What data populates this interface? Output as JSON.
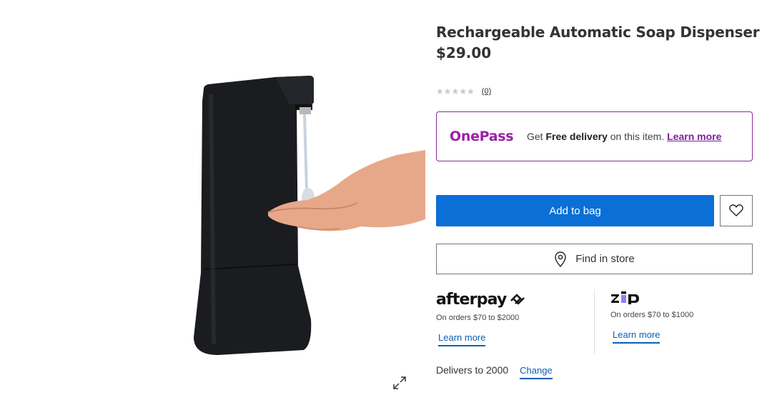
{
  "product": {
    "title": "Rechargeable Automatic Soap Dispenser",
    "price": "$29.00",
    "rating_stars": "★★★★★",
    "review_count": "(0)"
  },
  "onepass": {
    "logo": "OnePass",
    "text_prefix": "Get ",
    "text_bold": "Free delivery",
    "text_suffix": " on this item.  ",
    "link": "Learn more",
    "brand_color": "#9b1fa8"
  },
  "actions": {
    "add_to_bag": "Add to bag",
    "find_in_store": "Find in store",
    "primary_color": "#0a6fd6"
  },
  "payments": {
    "afterpay": {
      "logo": "afterpay",
      "note": "On orders $70 to $2000",
      "link": "Learn more"
    },
    "zip": {
      "logo": "zip",
      "note": "On orders $70 to $1000",
      "link": "Learn more",
      "accent_color": "#9b7bf2"
    }
  },
  "delivery": {
    "text": "Delivers to 2000",
    "change": "Change"
  }
}
